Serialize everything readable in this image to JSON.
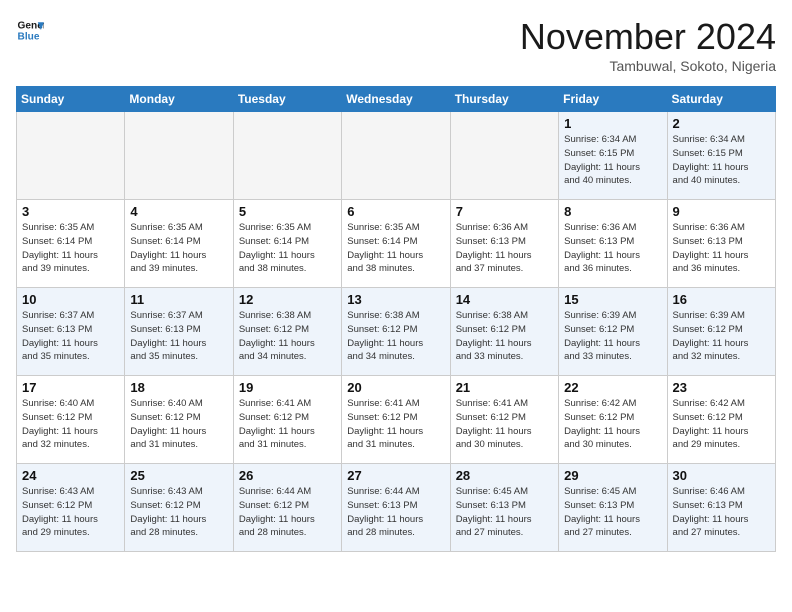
{
  "header": {
    "logo_line1": "General",
    "logo_line2": "Blue",
    "month": "November 2024",
    "location": "Tambuwal, Sokoto, Nigeria"
  },
  "weekdays": [
    "Sunday",
    "Monday",
    "Tuesday",
    "Wednesday",
    "Thursday",
    "Friday",
    "Saturday"
  ],
  "weeks": [
    [
      {
        "day": "",
        "info": ""
      },
      {
        "day": "",
        "info": ""
      },
      {
        "day": "",
        "info": ""
      },
      {
        "day": "",
        "info": ""
      },
      {
        "day": "",
        "info": ""
      },
      {
        "day": "1",
        "info": "Sunrise: 6:34 AM\nSunset: 6:15 PM\nDaylight: 11 hours\nand 40 minutes."
      },
      {
        "day": "2",
        "info": "Sunrise: 6:34 AM\nSunset: 6:15 PM\nDaylight: 11 hours\nand 40 minutes."
      }
    ],
    [
      {
        "day": "3",
        "info": "Sunrise: 6:35 AM\nSunset: 6:14 PM\nDaylight: 11 hours\nand 39 minutes."
      },
      {
        "day": "4",
        "info": "Sunrise: 6:35 AM\nSunset: 6:14 PM\nDaylight: 11 hours\nand 39 minutes."
      },
      {
        "day": "5",
        "info": "Sunrise: 6:35 AM\nSunset: 6:14 PM\nDaylight: 11 hours\nand 38 minutes."
      },
      {
        "day": "6",
        "info": "Sunrise: 6:35 AM\nSunset: 6:14 PM\nDaylight: 11 hours\nand 38 minutes."
      },
      {
        "day": "7",
        "info": "Sunrise: 6:36 AM\nSunset: 6:13 PM\nDaylight: 11 hours\nand 37 minutes."
      },
      {
        "day": "8",
        "info": "Sunrise: 6:36 AM\nSunset: 6:13 PM\nDaylight: 11 hours\nand 36 minutes."
      },
      {
        "day": "9",
        "info": "Sunrise: 6:36 AM\nSunset: 6:13 PM\nDaylight: 11 hours\nand 36 minutes."
      }
    ],
    [
      {
        "day": "10",
        "info": "Sunrise: 6:37 AM\nSunset: 6:13 PM\nDaylight: 11 hours\nand 35 minutes."
      },
      {
        "day": "11",
        "info": "Sunrise: 6:37 AM\nSunset: 6:13 PM\nDaylight: 11 hours\nand 35 minutes."
      },
      {
        "day": "12",
        "info": "Sunrise: 6:38 AM\nSunset: 6:12 PM\nDaylight: 11 hours\nand 34 minutes."
      },
      {
        "day": "13",
        "info": "Sunrise: 6:38 AM\nSunset: 6:12 PM\nDaylight: 11 hours\nand 34 minutes."
      },
      {
        "day": "14",
        "info": "Sunrise: 6:38 AM\nSunset: 6:12 PM\nDaylight: 11 hours\nand 33 minutes."
      },
      {
        "day": "15",
        "info": "Sunrise: 6:39 AM\nSunset: 6:12 PM\nDaylight: 11 hours\nand 33 minutes."
      },
      {
        "day": "16",
        "info": "Sunrise: 6:39 AM\nSunset: 6:12 PM\nDaylight: 11 hours\nand 32 minutes."
      }
    ],
    [
      {
        "day": "17",
        "info": "Sunrise: 6:40 AM\nSunset: 6:12 PM\nDaylight: 11 hours\nand 32 minutes."
      },
      {
        "day": "18",
        "info": "Sunrise: 6:40 AM\nSunset: 6:12 PM\nDaylight: 11 hours\nand 31 minutes."
      },
      {
        "day": "19",
        "info": "Sunrise: 6:41 AM\nSunset: 6:12 PM\nDaylight: 11 hours\nand 31 minutes."
      },
      {
        "day": "20",
        "info": "Sunrise: 6:41 AM\nSunset: 6:12 PM\nDaylight: 11 hours\nand 31 minutes."
      },
      {
        "day": "21",
        "info": "Sunrise: 6:41 AM\nSunset: 6:12 PM\nDaylight: 11 hours\nand 30 minutes."
      },
      {
        "day": "22",
        "info": "Sunrise: 6:42 AM\nSunset: 6:12 PM\nDaylight: 11 hours\nand 30 minutes."
      },
      {
        "day": "23",
        "info": "Sunrise: 6:42 AM\nSunset: 6:12 PM\nDaylight: 11 hours\nand 29 minutes."
      }
    ],
    [
      {
        "day": "24",
        "info": "Sunrise: 6:43 AM\nSunset: 6:12 PM\nDaylight: 11 hours\nand 29 minutes."
      },
      {
        "day": "25",
        "info": "Sunrise: 6:43 AM\nSunset: 6:12 PM\nDaylight: 11 hours\nand 28 minutes."
      },
      {
        "day": "26",
        "info": "Sunrise: 6:44 AM\nSunset: 6:12 PM\nDaylight: 11 hours\nand 28 minutes."
      },
      {
        "day": "27",
        "info": "Sunrise: 6:44 AM\nSunset: 6:13 PM\nDaylight: 11 hours\nand 28 minutes."
      },
      {
        "day": "28",
        "info": "Sunrise: 6:45 AM\nSunset: 6:13 PM\nDaylight: 11 hours\nand 27 minutes."
      },
      {
        "day": "29",
        "info": "Sunrise: 6:45 AM\nSunset: 6:13 PM\nDaylight: 11 hours\nand 27 minutes."
      },
      {
        "day": "30",
        "info": "Sunrise: 6:46 AM\nSunset: 6:13 PM\nDaylight: 11 hours\nand 27 minutes."
      }
    ]
  ]
}
